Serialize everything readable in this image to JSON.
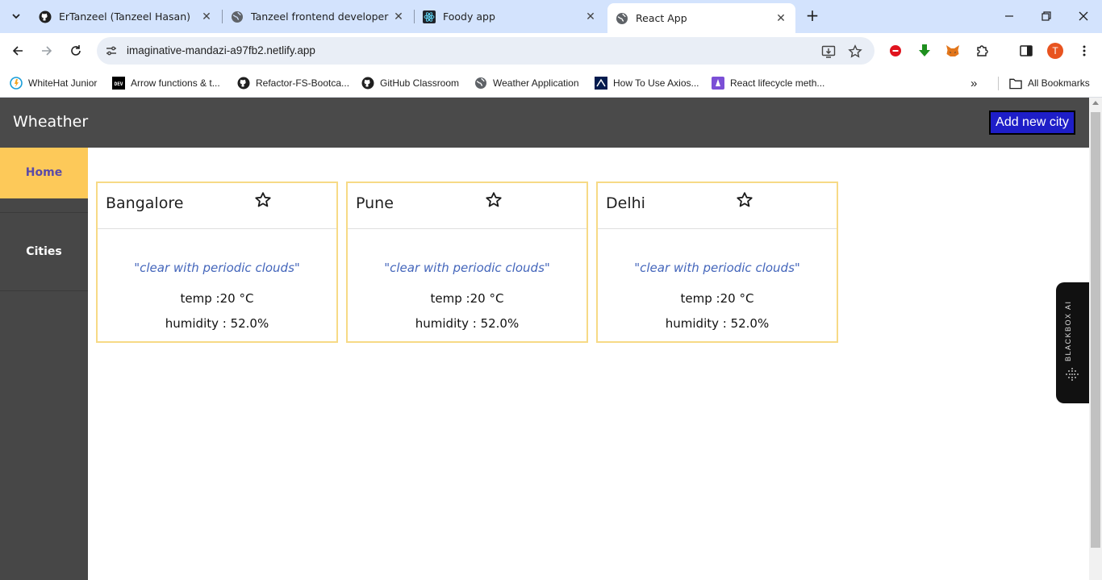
{
  "browser": {
    "tabs": [
      {
        "title": "ErTanzeel (Tanzeel Hasan)",
        "icon": "github-icon",
        "active": false
      },
      {
        "title": "Tanzeel frontend developer",
        "icon": "globe-icon",
        "active": false
      },
      {
        "title": "Foody app",
        "icon": "react-icon",
        "active": false
      },
      {
        "title": "React App",
        "icon": "globe-icon",
        "active": true
      }
    ],
    "url": "imaginative-mandazi-a97fb2.netlify.app",
    "profile_initial": "T",
    "bookmarks": [
      {
        "label": "WhiteHat Junior",
        "icon": "whitehat-icon"
      },
      {
        "label": "Arrow functions & t...",
        "icon": "dev-icon"
      },
      {
        "label": "Refactor-FS-Bootca...",
        "icon": "github-icon"
      },
      {
        "label": "GitHub Classroom",
        "icon": "github-icon"
      },
      {
        "label": "Weather Application",
        "icon": "globe-icon"
      },
      {
        "label": "How To Use Axios...",
        "icon": "digitalocean-icon"
      },
      {
        "label": "React lifecycle meth...",
        "icon": "bookmark-icon"
      }
    ],
    "more_bookmarks": "»",
    "all_bookmarks": "All Bookmarks"
  },
  "app": {
    "brand": "Wheather",
    "add_city_label": "Add new city",
    "sidebar": {
      "home": "Home",
      "cities": "Cities"
    },
    "cards": [
      {
        "city": "Bangalore",
        "description": "\"clear with periodic clouds\"",
        "temp": "temp :20 °C",
        "humidity": "humidity : 52.0%"
      },
      {
        "city": "Pune",
        "description": "\"clear with periodic clouds\"",
        "temp": "temp :20 °C",
        "humidity": "humidity : 52.0%"
      },
      {
        "city": "Delhi",
        "description": "\"clear with periodic clouds\"",
        "temp": "temp :20 °C",
        "humidity": "humidity : 52.0%"
      }
    ]
  },
  "widget": {
    "label": "BLACKBOX AI"
  },
  "colors": {
    "header_bg": "#4a4a4a",
    "sidebar_active": "#fdc959",
    "card_border": "#f7da86",
    "add_button": "#1e1ec8",
    "description_text": "#4466bb"
  }
}
